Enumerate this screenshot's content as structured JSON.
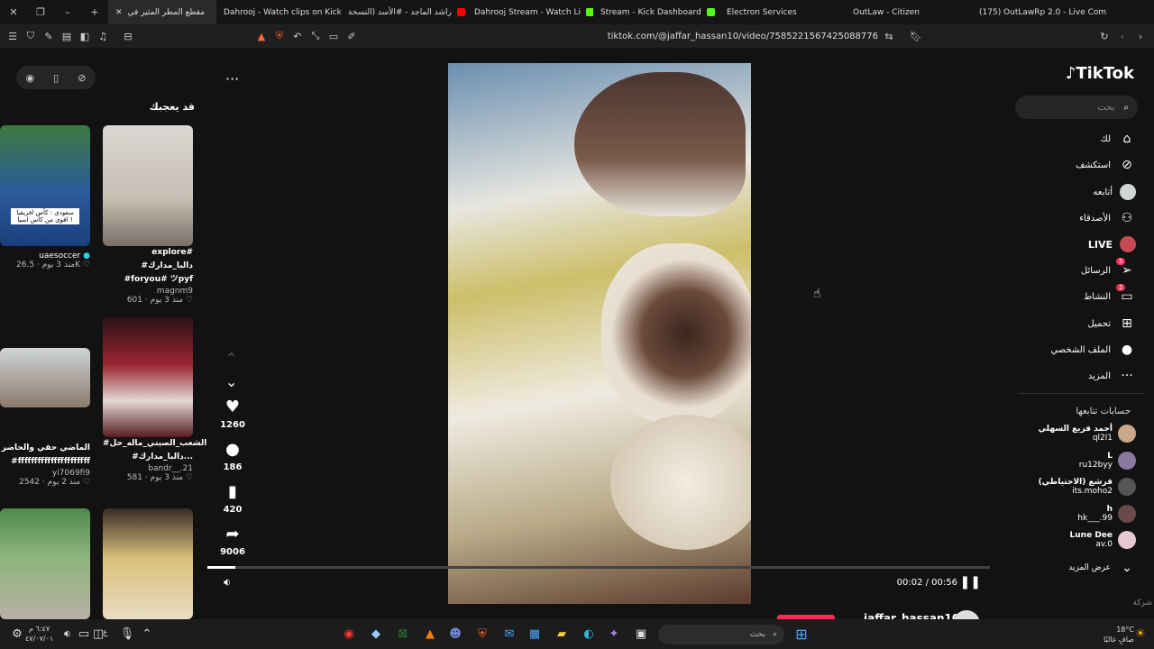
{
  "browser": {
    "tabs": [
      {
        "label": "مقطع المطر المثير في",
        "active": true,
        "color": "#ffffff"
      },
      {
        "label": "Dahrooj - Watch clips on Kick",
        "color": "#53fc18"
      },
      {
        "label": "راشد الماجد - #الأسد (النسخة",
        "color": "#ff0000"
      },
      {
        "label": "Dahrooj Stream - Watch Li",
        "color": "#53fc18"
      },
      {
        "label": "Stream - Kick Dashboard",
        "color": "#53fc18"
      },
      {
        "label": "Electron Services",
        "color": "#53fc18"
      },
      {
        "label": "OutLaw - Citizen",
        "color": "#5aa0ff"
      },
      {
        "label": "(175) OutLawRp 2.0 - Live Com",
        "color": "#20c997"
      }
    ],
    "url": "tiktok.com/@jaffar_hassan10/video/7585221567425088776",
    "badge_count": "7"
  },
  "left": {
    "section_title": "قد يعجبك",
    "cards": [
      {
        "caption1": "explore# #دالبا_مدارك",
        "caption2": "#foryou# ツpyf",
        "user": "magnm9",
        "likes": "601",
        "time": "منذ 3 يوم"
      },
      {
        "caption1": "",
        "caption2": "",
        "user": "uaesoccer",
        "likes": "26.5K",
        "time": "منذ 3 يوم",
        "overlay": "سعودي : كأس افريقيا اقوى من كأس اسيا !"
      },
      {
        "caption1": "#الشعب_الصيني_ماله_حل",
        "caption2": "#دالبا_مدارك...",
        "user": "bandr__.21",
        "likes": "581",
        "time": "منذ 3 يوم"
      },
      {
        "caption1": "الماضي حقي والحاضر",
        "caption2": "#ffffffffffffffffffffff",
        "user": "yi7069fi9",
        "likes": "2542",
        "time": "منذ 2 يوم"
      }
    ]
  },
  "player": {
    "likes": "1260",
    "comments": "186",
    "saves": "420",
    "shares": "9006",
    "time": "00:02 / 00:56",
    "progress": 0.036,
    "author": "jaffar_hassan10"
  },
  "sidebar": {
    "logo": "TikTok",
    "search_placeholder": "بحث",
    "nav": [
      {
        "label": "لك",
        "icon": "home-icon"
      },
      {
        "label": "استكشف",
        "icon": "compass-icon"
      },
      {
        "label": "أتابعه",
        "icon": "following-icon"
      },
      {
        "label": "الأصدقاء",
        "icon": "friends-icon"
      },
      {
        "label": "LIVE",
        "icon": "live-icon"
      },
      {
        "label": "الرسائل",
        "icon": "messages-icon",
        "badge": "5"
      },
      {
        "label": "النشاط",
        "icon": "activity-icon",
        "badge": "2"
      },
      {
        "label": "تحميل",
        "icon": "upload-icon"
      },
      {
        "label": "الملف الشخصي",
        "icon": "profile-icon"
      },
      {
        "label": "المزيد",
        "icon": "more-icon"
      }
    ],
    "following_title": "حسابات تتابعها",
    "following": [
      {
        "name": "أحمد فزيع السهلي",
        "handle": "ql2l1"
      },
      {
        "name": "L",
        "handle": "ru12byy"
      },
      {
        "name": "قرشع (الاحتياطي)",
        "handle": "its.moho2"
      },
      {
        "name": "h",
        "handle": "hk___.99"
      },
      {
        "name": "Lune Dee",
        "handle": "av.0"
      }
    ],
    "show_more": "عرض المزيد",
    "company": "شركة"
  },
  "taskbar": {
    "time": "٦:٤٧ م",
    "date": "٤٧/٠٧/٠١",
    "weather": "18°C",
    "weather_desc": "صافٍ غالبًا",
    "search": "بحث",
    "lang": "ع"
  }
}
